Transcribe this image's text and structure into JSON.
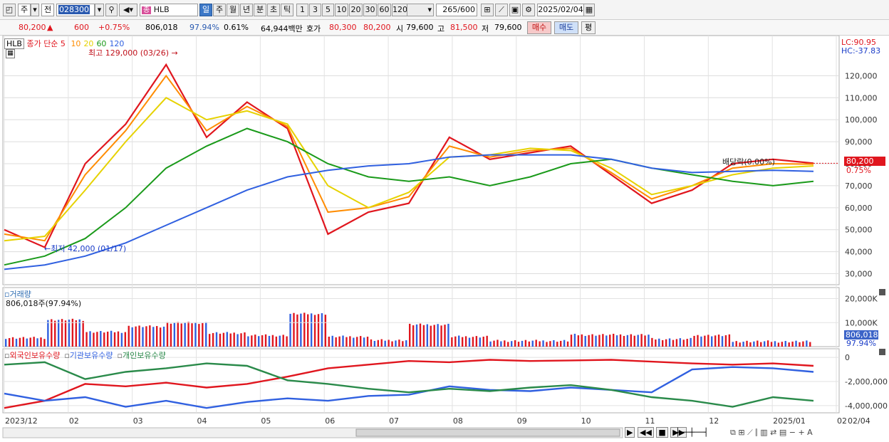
{
  "toolbar": {
    "tab_stock": "주",
    "tab_all": "전",
    "code": "028300",
    "stock_badge": "종",
    "stock_name": "HLB",
    "periods": [
      "일",
      "주",
      "월",
      "년",
      "분",
      "초",
      "틱"
    ],
    "active_period": "일",
    "intervals": [
      "1",
      "3",
      "5",
      "10",
      "20",
      "30",
      "60",
      "120"
    ],
    "count": "265",
    "count_total": "/600",
    "date": "2025/02/04"
  },
  "quote": {
    "price": "80,200",
    "change_arrow": "▲",
    "change": "600",
    "change_pct": "+0.75%",
    "volume": "806,018",
    "volume_ratio": "97.94%",
    "turnover": "0.61%",
    "amount": "64,944백만",
    "ask_label": "호가",
    "ask": "80,300",
    "bid": "80,200",
    "open_label": "시",
    "open": "79,600",
    "high_label": "고",
    "high": "81,500",
    "low_label": "저",
    "low": "79,600",
    "buy_button": "매수",
    "sell_button": "매도",
    "eval_button": "평"
  },
  "price_panel": {
    "ticker_tag": "HLB",
    "legend_prefix": "종가 단순 5",
    "legend_ma": [
      {
        "label": "10",
        "color": "#ff8c00"
      },
      {
        "label": "20",
        "color": "#e6d200"
      },
      {
        "label": "60",
        "color": "#1a9a1a"
      },
      {
        "label": "120",
        "color": "#3060e0"
      }
    ],
    "high_note": "최고 129,000 (03/26)",
    "low_note": "최저 42,000 (01/17)",
    "dividend_note": "배당락(0.00%)",
    "lc": "LC:90.95",
    "hc": "HC:-37.83",
    "current_price_tag": "80,200",
    "current_pct_tag": "0.75%"
  },
  "volume_panel": {
    "title": "거래량",
    "value": "806,018주(97.94%)",
    "current_tag": "806,018",
    "current_pct": "97.94%"
  },
  "holding_panel": {
    "legend": [
      {
        "label": "외국인보유수량",
        "color": "#e0161e"
      },
      {
        "label": "기관보유수량",
        "color": "#3060e0"
      },
      {
        "label": "개인보유수량",
        "color": "#2a8a4a"
      }
    ]
  },
  "x_axis": [
    "2023/12",
    "02",
    "03",
    "04",
    "05",
    "06",
    "07",
    "08",
    "09",
    "10",
    "11",
    "12",
    "2025/01",
    "02"
  ],
  "x_axis_right": "02/04",
  "chart_data": {
    "type": "line",
    "title": "",
    "price_axis": {
      "ticks": [
        "120,000",
        "110,000",
        "100,000",
        "90,000",
        "80,000",
        "70,000",
        "60,000",
        "50,000",
        "40,000",
        "30,000"
      ],
      "ylim": [
        25000,
        135000
      ]
    },
    "volume_axis": {
      "ticks": [
        "20,000K",
        "10,000K"
      ]
    },
    "holding_axis": {
      "ticks": [
        "0",
        "-2,000,000",
        "-4,000,000"
      ],
      "ylim": [
        -4600000,
        600000
      ]
    },
    "x": [
      "2023/12",
      "02",
      "03",
      "04",
      "05",
      "06",
      "07",
      "08",
      "09",
      "10",
      "11",
      "12",
      "2025/01",
      "02"
    ],
    "series": [
      {
        "name": "5",
        "color": "#e0161e",
        "values": [
          50000,
          42000,
          80000,
          98000,
          125000,
          92000,
          108000,
          96000,
          48000,
          58000,
          62000,
          92000,
          82000,
          85000,
          88000,
          75000,
          62000,
          68000,
          80000,
          82000,
          80200
        ]
      },
      {
        "name": "10",
        "color": "#ff8c00",
        "values": [
          48000,
          45000,
          75000,
          95000,
          120000,
          95000,
          106000,
          97000,
          58000,
          60000,
          65000,
          88000,
          83000,
          86000,
          87000,
          76000,
          64000,
          70000,
          78000,
          80000,
          79800
        ]
      },
      {
        "name": "20",
        "color": "#e6d200",
        "values": [
          45000,
          47000,
          68000,
          90000,
          110000,
          100000,
          104000,
          98000,
          70000,
          60000,
          67000,
          83000,
          84000,
          87000,
          86000,
          78000,
          66000,
          70000,
          75000,
          78000,
          79000
        ]
      },
      {
        "name": "60",
        "color": "#1a9a1a",
        "values": [
          34000,
          38000,
          46000,
          60000,
          78000,
          88000,
          96000,
          90000,
          80000,
          74000,
          72000,
          74000,
          70000,
          74000,
          80000,
          82000,
          78000,
          75000,
          72000,
          70000,
          72000
        ]
      },
      {
        "name": "120",
        "color": "#3060e0",
        "values": [
          32000,
          34000,
          38000,
          44000,
          52000,
          60000,
          68000,
          74000,
          77000,
          79000,
          80000,
          83000,
          84000,
          84000,
          84000,
          82000,
          78000,
          76000,
          76500,
          77000,
          76500
        ]
      }
    ],
    "holdings": [
      {
        "name": "외국인보유수량",
        "color": "#e0161e",
        "values": [
          -4200000,
          -3600000,
          -2200000,
          -2400000,
          -2100000,
          -2500000,
          -2200000,
          -1600000,
          -900000,
          -600000,
          -300000,
          -400000,
          -200000,
          -300000,
          -250000,
          -200000,
          -350000,
          -500000,
          -600000,
          -500000,
          -700000
        ]
      },
      {
        "name": "기관보유수량",
        "color": "#3060e0",
        "values": [
          -3000000,
          -3600000,
          -3300000,
          -4100000,
          -3600000,
          -4200000,
          -3700000,
          -3400000,
          -3600000,
          -3200000,
          -3100000,
          -2400000,
          -2700000,
          -2800000,
          -2500000,
          -2700000,
          -2900000,
          -1000000,
          -800000,
          -900000,
          -1200000
        ]
      },
      {
        "name": "개인보유수량",
        "color": "#2a8a4a",
        "values": [
          -600000,
          -400000,
          -1800000,
          -1200000,
          -900000,
          -500000,
          -700000,
          -1900000,
          -2200000,
          -2600000,
          -2900000,
          -2600000,
          -2800000,
          -2500000,
          -2300000,
          -2700000,
          -3300000,
          -3600000,
          -4100000,
          -3300000,
          -3600000
        ]
      }
    ]
  }
}
